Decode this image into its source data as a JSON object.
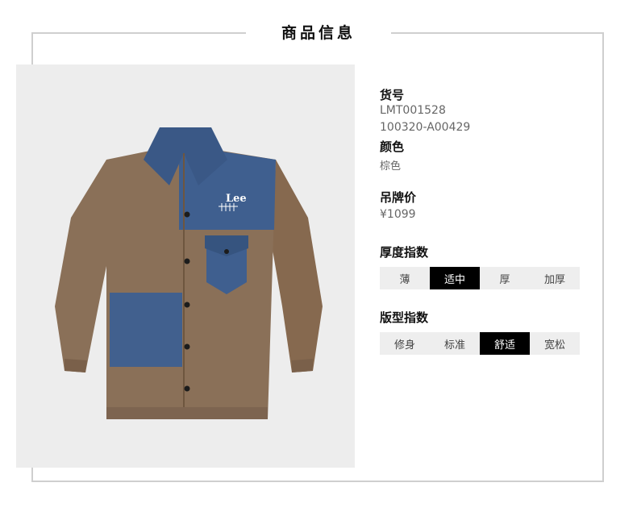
{
  "header": {
    "title": "商品信息"
  },
  "product": {
    "sku_label": "货号",
    "sku_code": "LMT001528",
    "sku_style": "100320-A00429",
    "color_label": "颜色",
    "color_value": "棕色",
    "price_label": "吊牌价",
    "price_value": "¥1099",
    "garment_logo": "Lee"
  },
  "thickness": {
    "label": "厚度指数",
    "options": [
      "薄",
      "适中",
      "厚",
      "加厚"
    ],
    "selected": "适中"
  },
  "fit": {
    "label": "版型指数",
    "options": [
      "修身",
      "标准",
      "舒适",
      "宽松"
    ],
    "selected": "舒适"
  },
  "colors": {
    "frame": "#cfcfcf",
    "photo_bg": "#ededed",
    "brown": "#8a7058",
    "denim": "#3f5f8f",
    "active": "#000000",
    "inactive_bg": "#eeeeee"
  }
}
